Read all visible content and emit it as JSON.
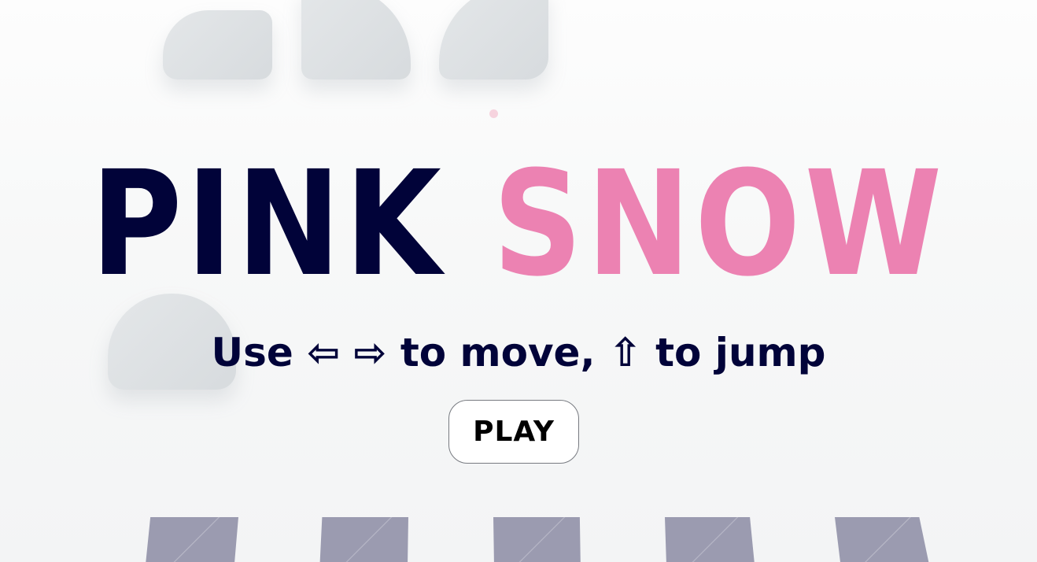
{
  "title": {
    "word_1": "PINK",
    "word_2": "SNOW",
    "color_1": "#010339",
    "color_2": "#ec82b2"
  },
  "instructions": "Use ⇦ ⇨ to move, ⇧ to jump",
  "play_button": {
    "label": "PLAY"
  },
  "scene": {
    "platform_color": "#d9dde0",
    "snowflake_color": "#f6d3de",
    "ground_tile_color": "#9b9bb0"
  }
}
